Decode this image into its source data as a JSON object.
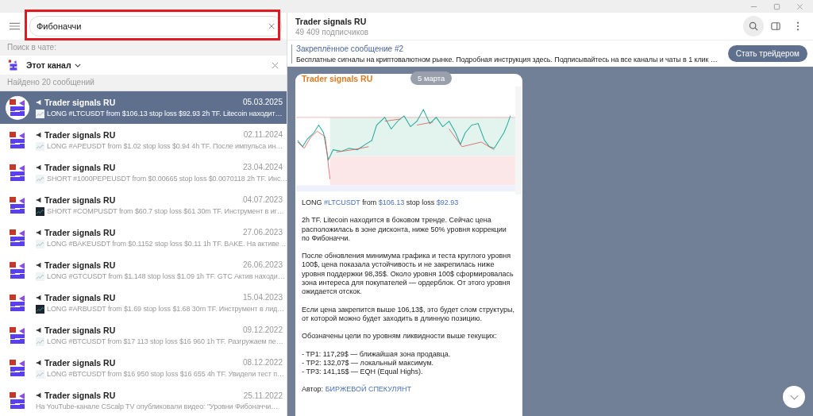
{
  "search": {
    "value": "Фибоначчи"
  },
  "search_in_chat_label": "Поиск в чате:",
  "scope": {
    "label": "Этот канал"
  },
  "results_count": "Найдено 20 сообщений",
  "results": [
    {
      "name": "Trader signals RU",
      "date": "05.03.2025",
      "kind": "light",
      "preview": "LONG #LTCUSDT from $106.13 stop loss $92.93  2h TF. Litecoin находит…",
      "selected": true
    },
    {
      "name": "Trader signals RU",
      "date": "02.11.2024",
      "kind": "light",
      "preview": "LONG #APEUSDT from $1.02 stop loss $0.94  4h TF. После импульса ин…",
      "selected": false
    },
    {
      "name": "Trader signals RU",
      "date": "23.04.2024",
      "kind": "light",
      "preview": "SHORT #1000PEPEUSDT from $0.00665 stop loss $0.0070118  2h TF. Инс…",
      "selected": false
    },
    {
      "name": "Trader signals RU",
      "date": "04.07.2023",
      "kind": "dark",
      "preview": "SHORT #COMPUSDT from $60.7 stop loss $61  30m TF. Инструмент в иг…",
      "selected": false
    },
    {
      "name": "Trader signals RU",
      "date": "27.06.2023",
      "kind": "light",
      "preview": "LONG #BAKEUSDT from $0.1152 stop loss $0.11  1h TF. BAKE. На активе …",
      "selected": false
    },
    {
      "name": "Trader signals RU",
      "date": "26.06.2023",
      "kind": "light",
      "preview": "LONG #GTCUSDT from $1.148 stop loss $1.09  1h TF. GTC Актив находи…",
      "selected": false
    },
    {
      "name": "Trader signals RU",
      "date": "15.04.2023",
      "kind": "dark",
      "preview": "LONG #ARBUSDT from $1.69 stop loss $1.68  30m TF. Инструмент в лид…",
      "selected": false
    },
    {
      "name": "Trader signals RU",
      "date": "09.12.2022",
      "kind": "light",
      "preview": "LONG #BTCUSDT from $17 113 stop loss $16 960  1h TF. Разгружаем пе…",
      "selected": false
    },
    {
      "name": "Trader signals RU",
      "date": "08.12.2022",
      "kind": "light",
      "preview": "LONG #BTCUSDT from $16 950 stop loss $16 655  4h TF. Увидели тест п…",
      "selected": false
    },
    {
      "name": "Trader signals RU",
      "date": "25.11.2022",
      "kind": "text",
      "preview": "На YouTube-канале CScalp TV опубликовали видео: \"Уровни Фибоначчи…",
      "selected": false
    }
  ],
  "chat": {
    "title": "Trader signals RU",
    "subscribers": "49 409 подписчиков"
  },
  "pinned": {
    "title": "Закреплённое сообщение #2",
    "text": "Бесплатные сигналы на криптовалютном рынке. Подробная инструкция здесь.  Подписывайтесь на все каналы и чаты в 1 клик …",
    "button": "Стать трейдером"
  },
  "date_pill": "5 марта",
  "message": {
    "author": "Trader signals RU",
    "headline": [
      {
        "text": "LONG ",
        "link": false
      },
      {
        "text": "#LTCUSDT",
        "link": true
      },
      {
        "text": " from ",
        "link": false
      },
      {
        "text": "$106.13",
        "link": true
      },
      {
        "text": " stop loss ",
        "link": false
      },
      {
        "text": "$92.93",
        "link": true
      }
    ],
    "paragraphs": [
      "2h TF. Litecoin находится в боковом тренде. Сейчас цена расположилась в зоне дисконта, ниже 50% уровня коррекции по Фибоначчи.",
      "После обновления минимума графика и теста круглого уровня 100$, цена показала устойчивость и не закрепилась ниже уровня поддержки 98,35$. Около уровня 100$ сформировалась зона интереса для покупателей — ордерблок. От этого уровня ожидается отскок.",
      "Если цена закрепится выше 106,13$, это будет слом структуры, от которой можно будет заходить в длинную позицию.",
      "Обозначены цели по уровням ликвидности выше текущих:",
      "- TP1: 117,29$ — ближайшая зона продавца.\n- TP2: 132,07$ — локальный максимум.\n- TP3: 141,15$ — EQH (Equal Highs)."
    ],
    "author_label": "Автор:",
    "author_link": "БИРЖЕВОЙ СПЕКУЛЯНТ"
  }
}
